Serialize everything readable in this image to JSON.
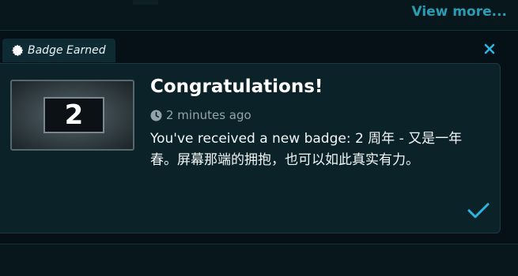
{
  "header": {
    "view_more_label": "View more..."
  },
  "notification": {
    "tab_label": "Badge Earned",
    "tab_icon": "badge-seal-icon",
    "close_icon": "close-icon",
    "badge_number": "2",
    "title": "Congratulations!",
    "time_icon": "clock-icon",
    "time_text": "2 minutes ago",
    "message": "You've received a new badge: 2 周年 - 又是一年春。屏幕那端的拥抱，也可以如此真实有力。",
    "ack_icon": "checkmark-icon"
  },
  "colors": {
    "accent": "#2a9db5",
    "check": "#2bb5e0",
    "card_bg": "#0c2229",
    "tab_bg": "#0e2a32",
    "page_bg": "#051116"
  }
}
